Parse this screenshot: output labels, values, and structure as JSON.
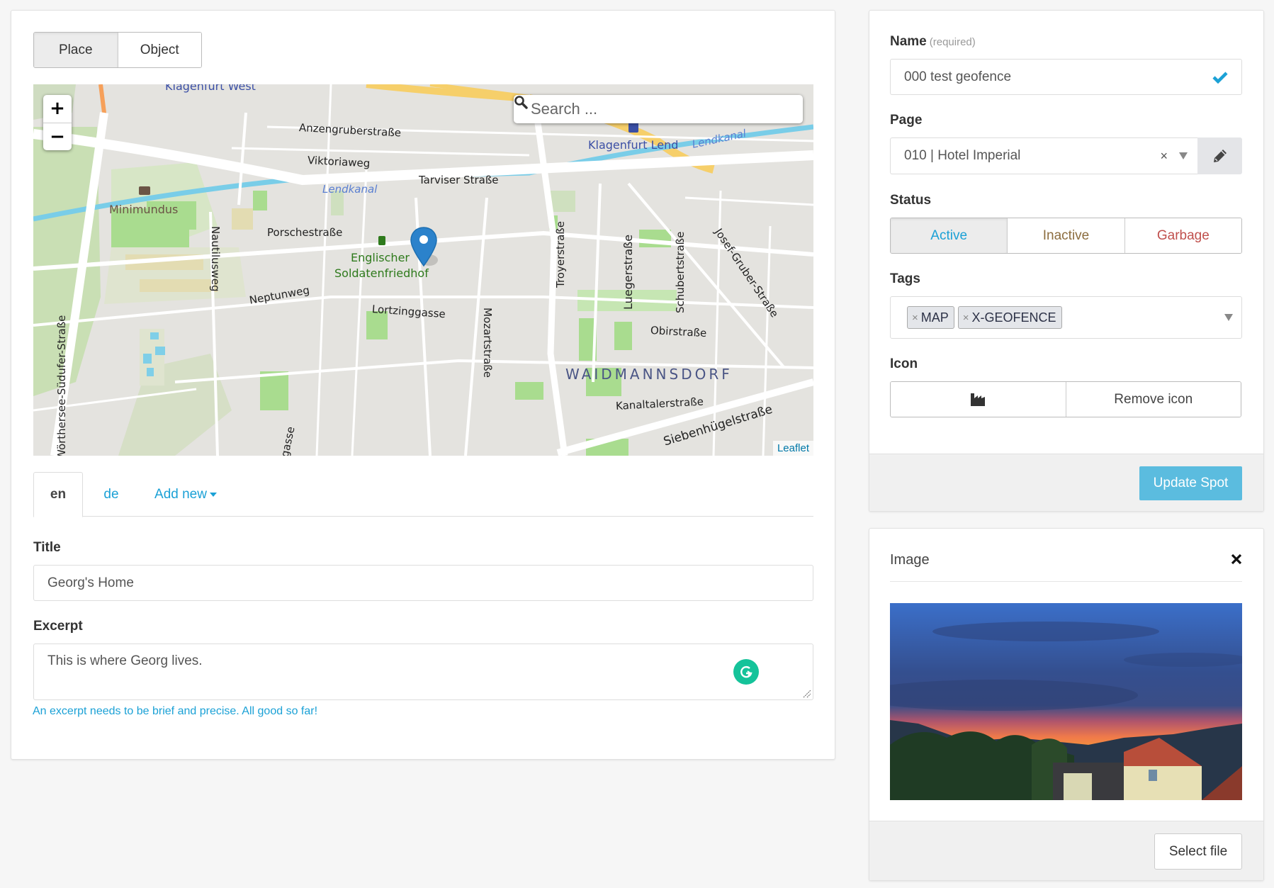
{
  "type_toggle": {
    "options": [
      "Place",
      "Object"
    ],
    "selected": "Place"
  },
  "map": {
    "zoom_in": "+",
    "zoom_out": "−",
    "search_placeholder": "Search ...",
    "attribution": "Leaflet",
    "labels": {
      "klagenfurt_west": "Klagenfurt West",
      "klagenfurt_lend": "Klagenfurt Lend",
      "anzengruberstrasse": "Anzengruberstraße",
      "viktoriaweg": "Viktoriaweg",
      "tarviser_strasse": "Tarviser Straße",
      "lendkanal": "Lendkanal",
      "minimundus": "Minimundus",
      "porschestrasse": "Porschestraße",
      "englischer": "Englischer",
      "soldatenfriedhof": "Soldatenfriedhof",
      "nautilusweg": "Nautilusweg",
      "neptunweg": "Neptunweg",
      "lortzinggasse": "Lortzinggasse",
      "mozartstrasse": "Mozartstraße",
      "troyerstrasse": "Troyerstraße",
      "luegerstrasse": "Luegerstraße",
      "schubertstrasse": "Schubertstraße",
      "josef_gruber_strasse": "Josef-Gruber-Straße",
      "obirstrasse": "Obirstraße",
      "waidmannsdorf": "WAIDMANNSDORF",
      "kanaltalerstrasse": "Kanaltalerstraße",
      "siebenhuegelstrasse": "Siebenhügelstraße",
      "woerthersee_suedufer": "Wörthersee-Südufer-Straße",
      "gasse": "lgasse"
    }
  },
  "lang_tabs": {
    "items": [
      "en",
      "de"
    ],
    "active": "en",
    "add_new": "Add new"
  },
  "title_field": {
    "label": "Title",
    "value": "Georg's Home"
  },
  "excerpt_field": {
    "label": "Excerpt",
    "value": "This is where Georg lives.",
    "help": "An excerpt needs to be brief and precise. All good so far!"
  },
  "spot_panel": {
    "name_label": "Name",
    "name_required": "(required)",
    "name_value": "000 test geofence",
    "page_label": "Page",
    "page_value": "010 | Hotel Imperial",
    "page_clear": "×",
    "status_label": "Status",
    "status_options": [
      {
        "label": "Active",
        "color": "#1ba1d6"
      },
      {
        "label": "Inactive",
        "color": "#8c6d3f"
      },
      {
        "label": "Garbage",
        "color": "#c0504d"
      }
    ],
    "status_selected": "Active",
    "tags_label": "Tags",
    "tags": [
      "MAP",
      "X-GEOFENCE"
    ],
    "tag_remove": "×",
    "icon_label": "Icon",
    "icon_name": "industry-icon",
    "remove_icon": "Remove icon",
    "update_button": "Update Spot"
  },
  "image_panel": {
    "title": "Image",
    "close": "×",
    "select_file": "Select file"
  },
  "colors": {
    "accent": "#1ba1d6",
    "primary_button": "#5bbcdf",
    "grammarly": "#15c39a",
    "marker": "#2b82cb"
  }
}
